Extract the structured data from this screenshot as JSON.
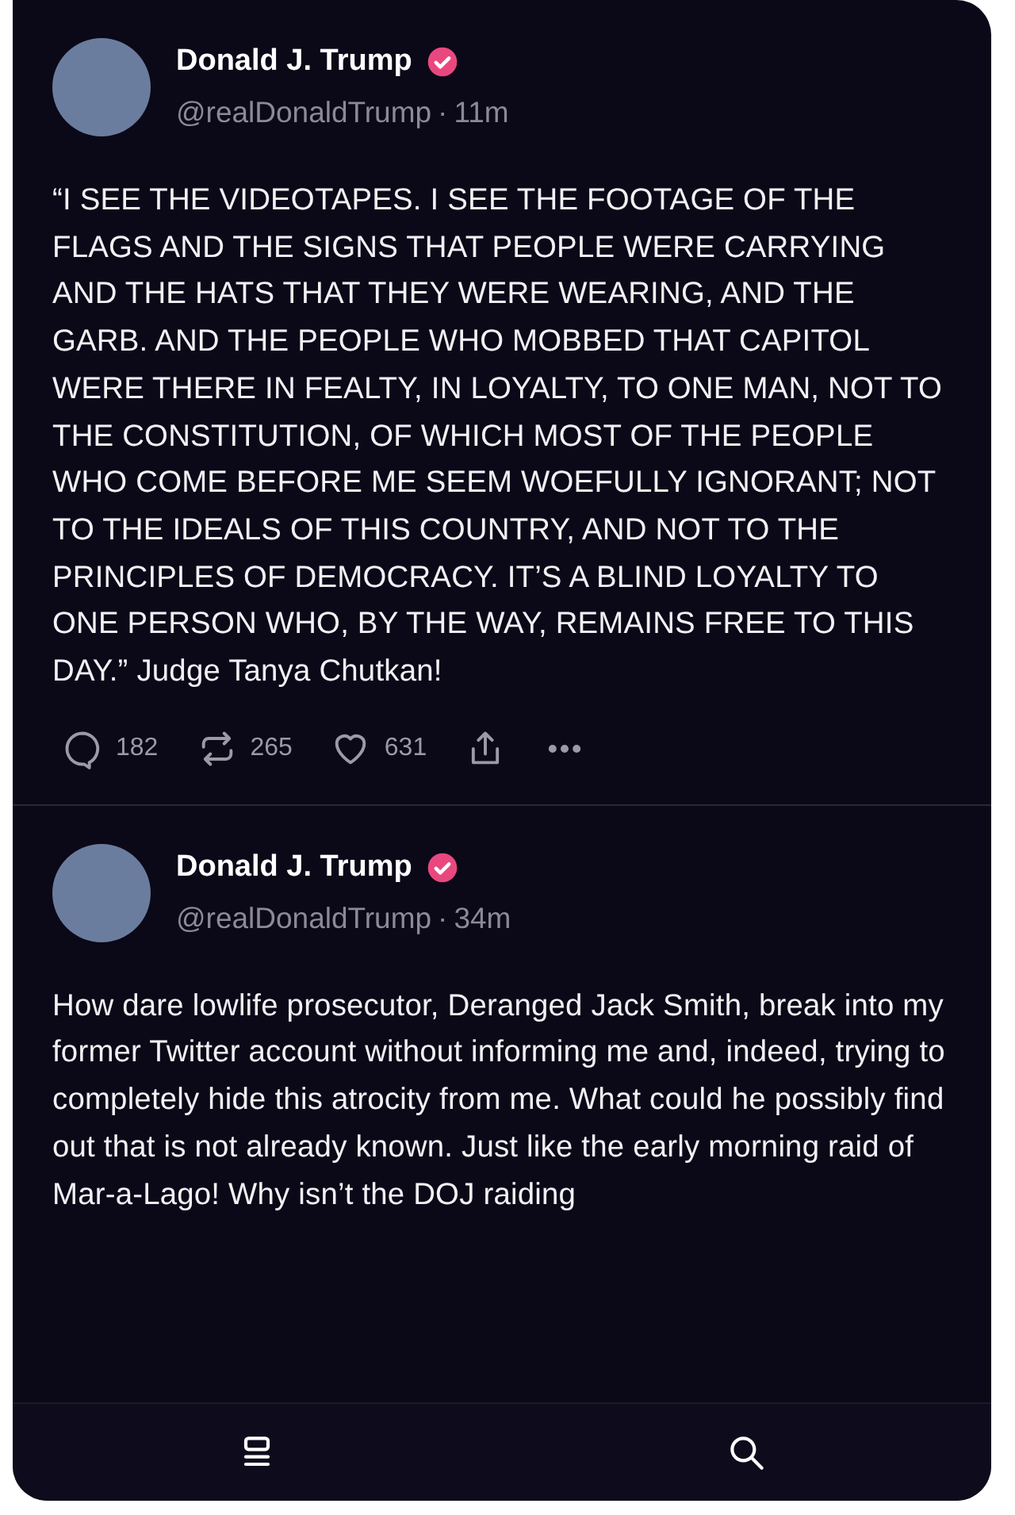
{
  "posts": [
    {
      "author": "Donald J. Trump",
      "verified": true,
      "handle": "@realDonaldTrump",
      "separator": "·",
      "time": "11m",
      "text": "“I SEE THE VIDEOTAPES. I SEE THE FOOTAGE OF THE FLAGS AND THE SIGNS THAT PEOPLE WERE CARRYING AND THE HATS THAT THEY WERE WEARING, AND THE GARB. AND THE PEOPLE WHO MOBBED THAT CAPITOL WERE THERE IN FEALTY, IN LOYALTY, TO ONE MAN, NOT TO THE CONSTITUTION, OF WHICH MOST OF THE PEOPLE WHO COME BEFORE ME SEEM WOEFULLY IGNORANT; NOT TO THE IDEALS OF THIS COUNTRY, AND NOT TO THE PRINCIPLES OF DEMOCRACY. IT’S A BLIND LOYALTY TO ONE PERSON WHO, BY THE WAY, REMAINS FREE TO THIS DAY.” Judge Tanya Chutkan!",
      "actions": {
        "replies": "182",
        "reposts": "265",
        "likes": "631"
      }
    },
    {
      "author": "Donald J. Trump",
      "verified": true,
      "handle": "@realDonaldTrump",
      "separator": "·",
      "time": "34m",
      "text": "How dare lowlife prosecutor, Deranged Jack Smith, break into my former Twitter account without informing me and,  indeed, trying to completely hide this atrocity from me. What could he possibly find out that is not already known. Just like the early morning raid of Mar-a-Lago! Why isn’t the DOJ raiding"
    }
  ],
  "nav": [
    {
      "kind": "feed"
    },
    {
      "kind": "search"
    }
  ]
}
